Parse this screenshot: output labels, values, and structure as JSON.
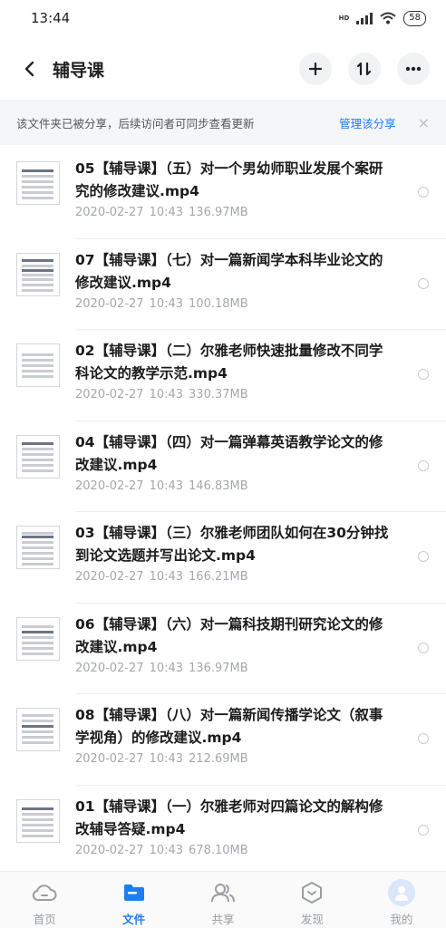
{
  "status_bar": {
    "time": "13:44",
    "network": "HD",
    "battery": "58"
  },
  "header": {
    "title": "辅导课"
  },
  "share_banner": {
    "text": "该文件夹已被分享，后续访问者可同步查看更新",
    "manage_label": "管理该分享",
    "close": "×"
  },
  "files": [
    {
      "name": "05【辅导课】（五）对一个男幼师职业发展个案研究的修改建议.mp4",
      "date": "2020-02-27",
      "time": "10:43",
      "size": "136.97MB"
    },
    {
      "name": "07【辅导课】（七）对一篇新闻学本科毕业论文的修改建议.mp4",
      "date": "2020-02-27",
      "time": "10:43",
      "size": "100.18MB"
    },
    {
      "name": "02【辅导课】（二）尔雅老师快速批量修改不同学科论文的教学示范.mp4",
      "date": "2020-02-27",
      "time": "10:43",
      "size": "330.37MB"
    },
    {
      "name": "04【辅导课】（四）对一篇弹幕英语教学论文的修改建议.mp4",
      "date": "2020-02-27",
      "time": "10:43",
      "size": "146.83MB"
    },
    {
      "name": "03【辅导课】（三）尔雅老师团队如何在30分钟找到论文选题并写出论文.mp4",
      "date": "2020-02-27",
      "time": "10:43",
      "size": "166.21MB"
    },
    {
      "name": "06【辅导课】（六）对一篇科技期刊研究论文的修改建议.mp4",
      "date": "2020-02-27",
      "time": "10:43",
      "size": "136.97MB"
    },
    {
      "name": "08【辅导课】（八）对一篇新闻传播学论文（叙事学视角）的修改建议.mp4",
      "date": "2020-02-27",
      "time": "10:43",
      "size": "212.69MB"
    },
    {
      "name": "01【辅导课】（一）尔雅老师对四篇论文的解构修改辅导答疑.mp4",
      "date": "2020-02-27",
      "time": "10:43",
      "size": "678.10MB"
    }
  ],
  "tab_bar": {
    "tabs": [
      {
        "label": "首页",
        "icon": "cloud-icon",
        "active": false
      },
      {
        "label": "文件",
        "icon": "folder-icon",
        "active": true
      },
      {
        "label": "共享",
        "icon": "people-icon",
        "active": false
      },
      {
        "label": "发现",
        "icon": "discover-icon",
        "active": false
      },
      {
        "label": "我的",
        "icon": "avatar-icon",
        "active": false
      }
    ]
  },
  "colors": {
    "accent": "#1e7ef0",
    "meta_text": "#a4a7ad"
  }
}
